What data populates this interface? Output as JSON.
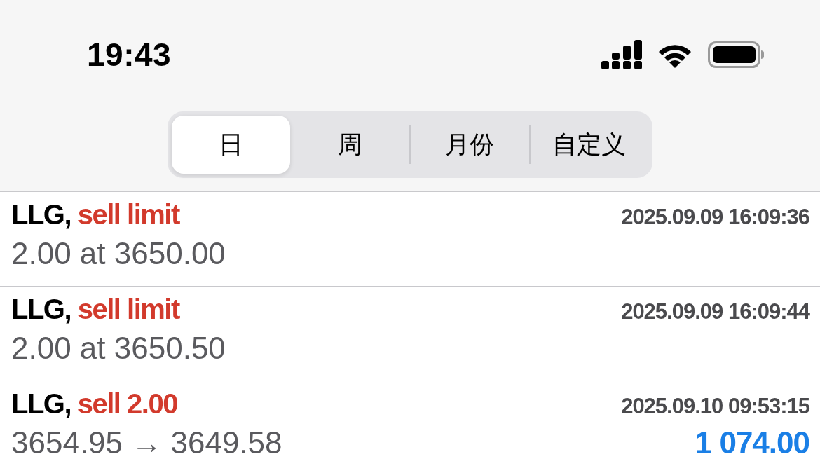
{
  "status_bar": {
    "time": "19:43"
  },
  "period_tabs": [
    {
      "label": "日",
      "selected": true
    },
    {
      "label": "周",
      "selected": false
    },
    {
      "label": "月份",
      "selected": false
    },
    {
      "label": "自定义",
      "selected": false
    }
  ],
  "orders": [
    {
      "symbol": "LLG,",
      "action": "sell limit",
      "time": "2025.09.09 16:09:36",
      "detail": "2.00 at 3650.00"
    },
    {
      "symbol": "LLG,",
      "action": "sell limit",
      "time": "2025.09.09 16:09:44",
      "detail": "2.00 at 3650.50"
    },
    {
      "symbol": "LLG,",
      "action": "sell 2.00",
      "time": "2025.09.10 09:53:15",
      "detail": "3654.95 → 3649.58",
      "profit": "1 074.00"
    }
  ]
}
